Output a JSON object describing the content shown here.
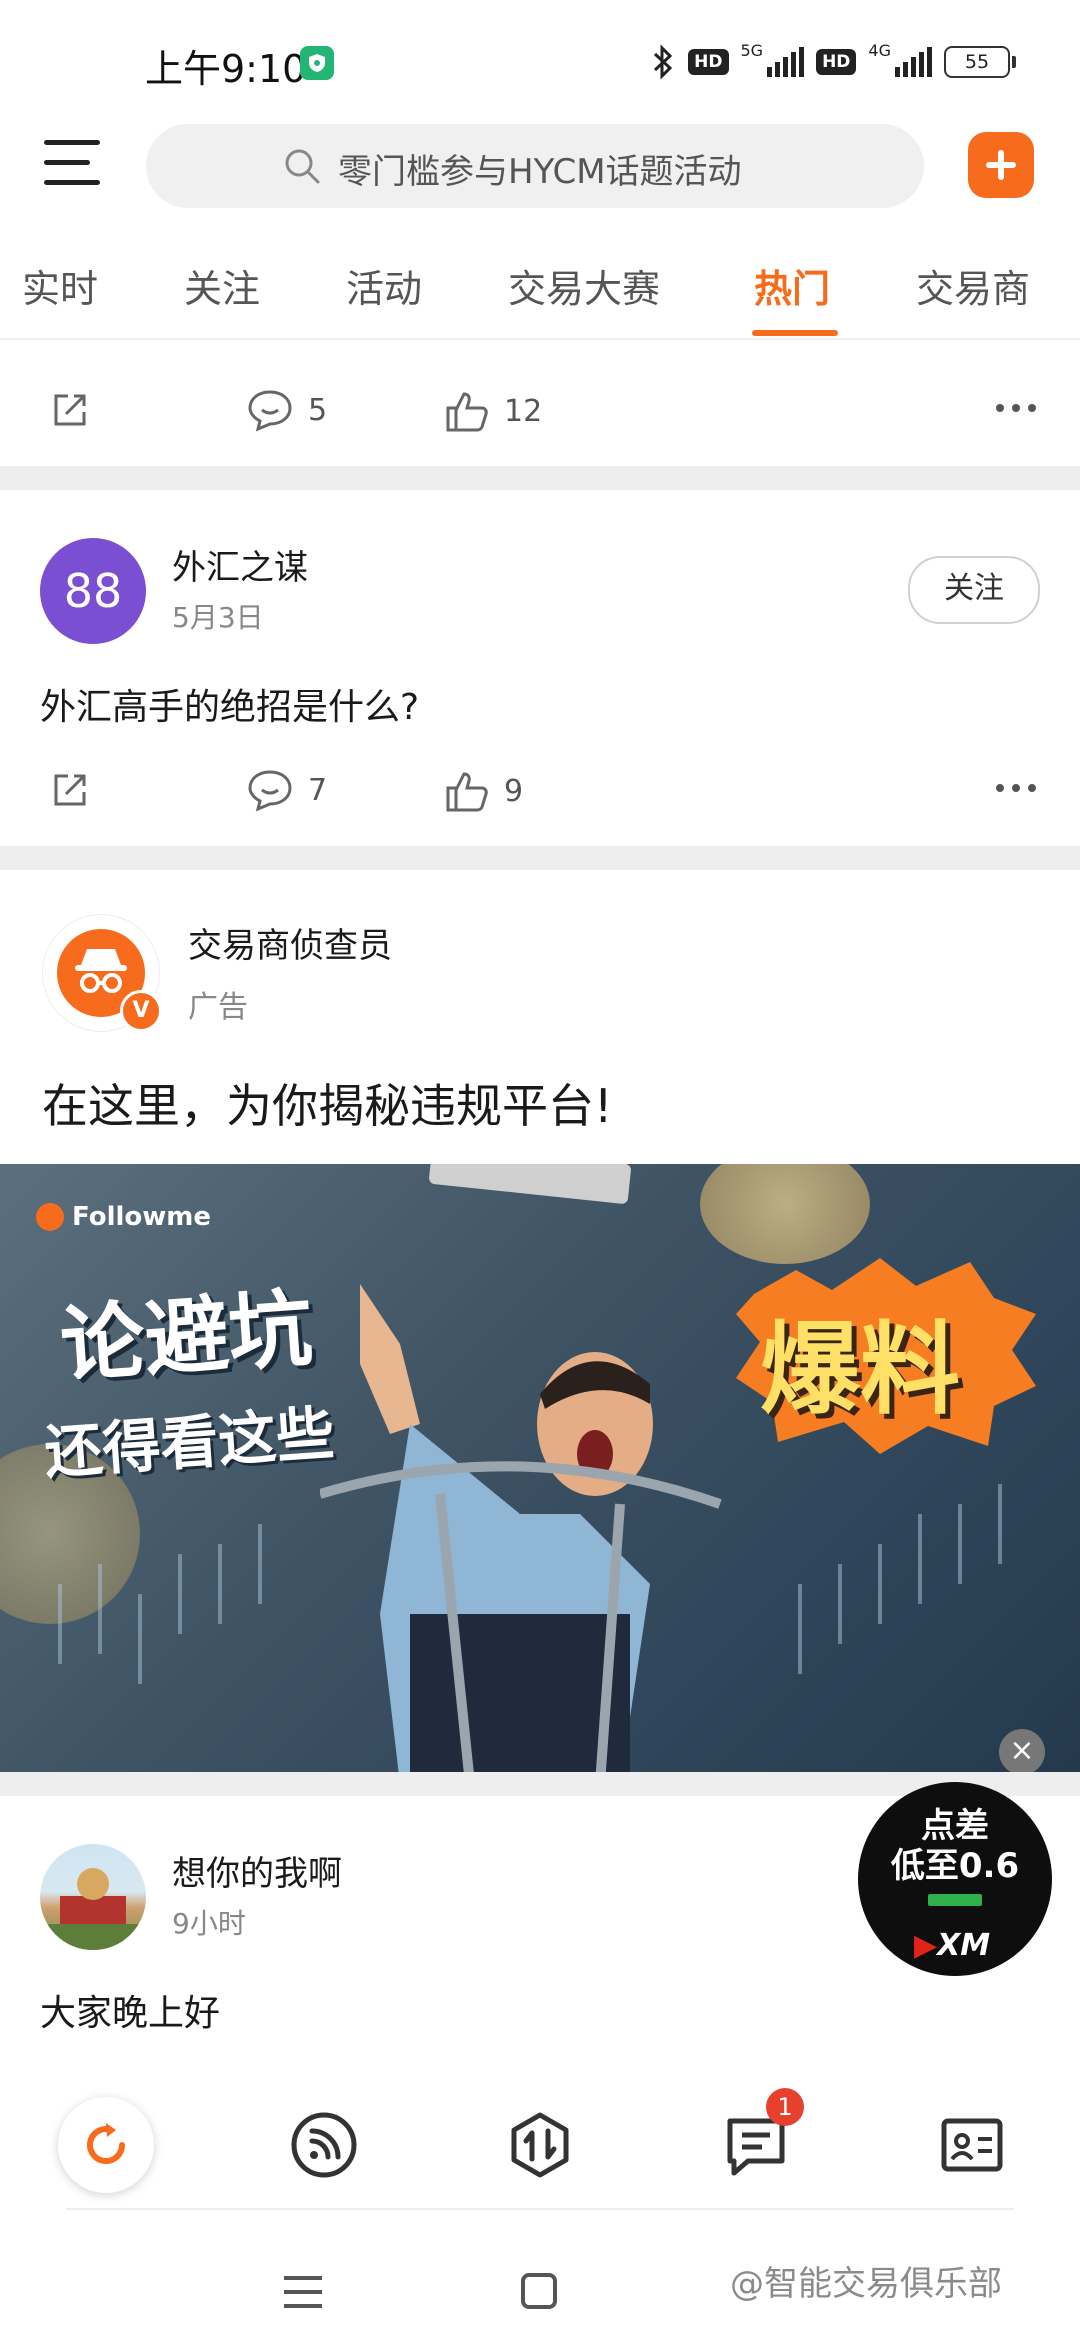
{
  "status_bar": {
    "time": "上午9:10",
    "network_1": "5G",
    "network_2": "4G",
    "hd_1": "HD",
    "hd_2": "HD",
    "battery": "55"
  },
  "top_bar": {
    "search_placeholder": "零门槛参与HYCM话题活动"
  },
  "tabs": [
    {
      "label": "实时"
    },
    {
      "label": "关注"
    },
    {
      "label": "活动"
    },
    {
      "label": "交易大赛"
    },
    {
      "label": "热门"
    },
    {
      "label": "交易商"
    }
  ],
  "active_tab": "热门",
  "feed": {
    "post_prev": {
      "comments": "5",
      "likes": "12"
    },
    "post_1": {
      "avatar_text": "88",
      "author": "外汇之谋",
      "date": "5月3日",
      "follow_label": "关注",
      "text": "外汇高手的绝招是什么?",
      "comments": "7",
      "likes": "9"
    },
    "ad": {
      "author": "交易商侦查员",
      "tag": "广告",
      "headline": "在这里，为你揭秘违规平台!",
      "verified_badge": "V",
      "banner": {
        "brand": "Followme",
        "line1": "论避坑",
        "line2": "还得看这些",
        "highlight": "爆料"
      },
      "close_label": "×"
    },
    "post_2": {
      "author": "想你的我啊",
      "date": "9小时",
      "text": "大家晚上好"
    }
  },
  "floating_ad": {
    "line1": "点差",
    "line2": "低至0.6",
    "brand": "XM"
  },
  "bottom_nav": {
    "messages_badge": "1"
  },
  "watermark": "@智能交易俱乐部",
  "colors": {
    "accent": "#f76b1c",
    "badge": "#e8402f",
    "avatar_88": "#7b4fd1"
  }
}
